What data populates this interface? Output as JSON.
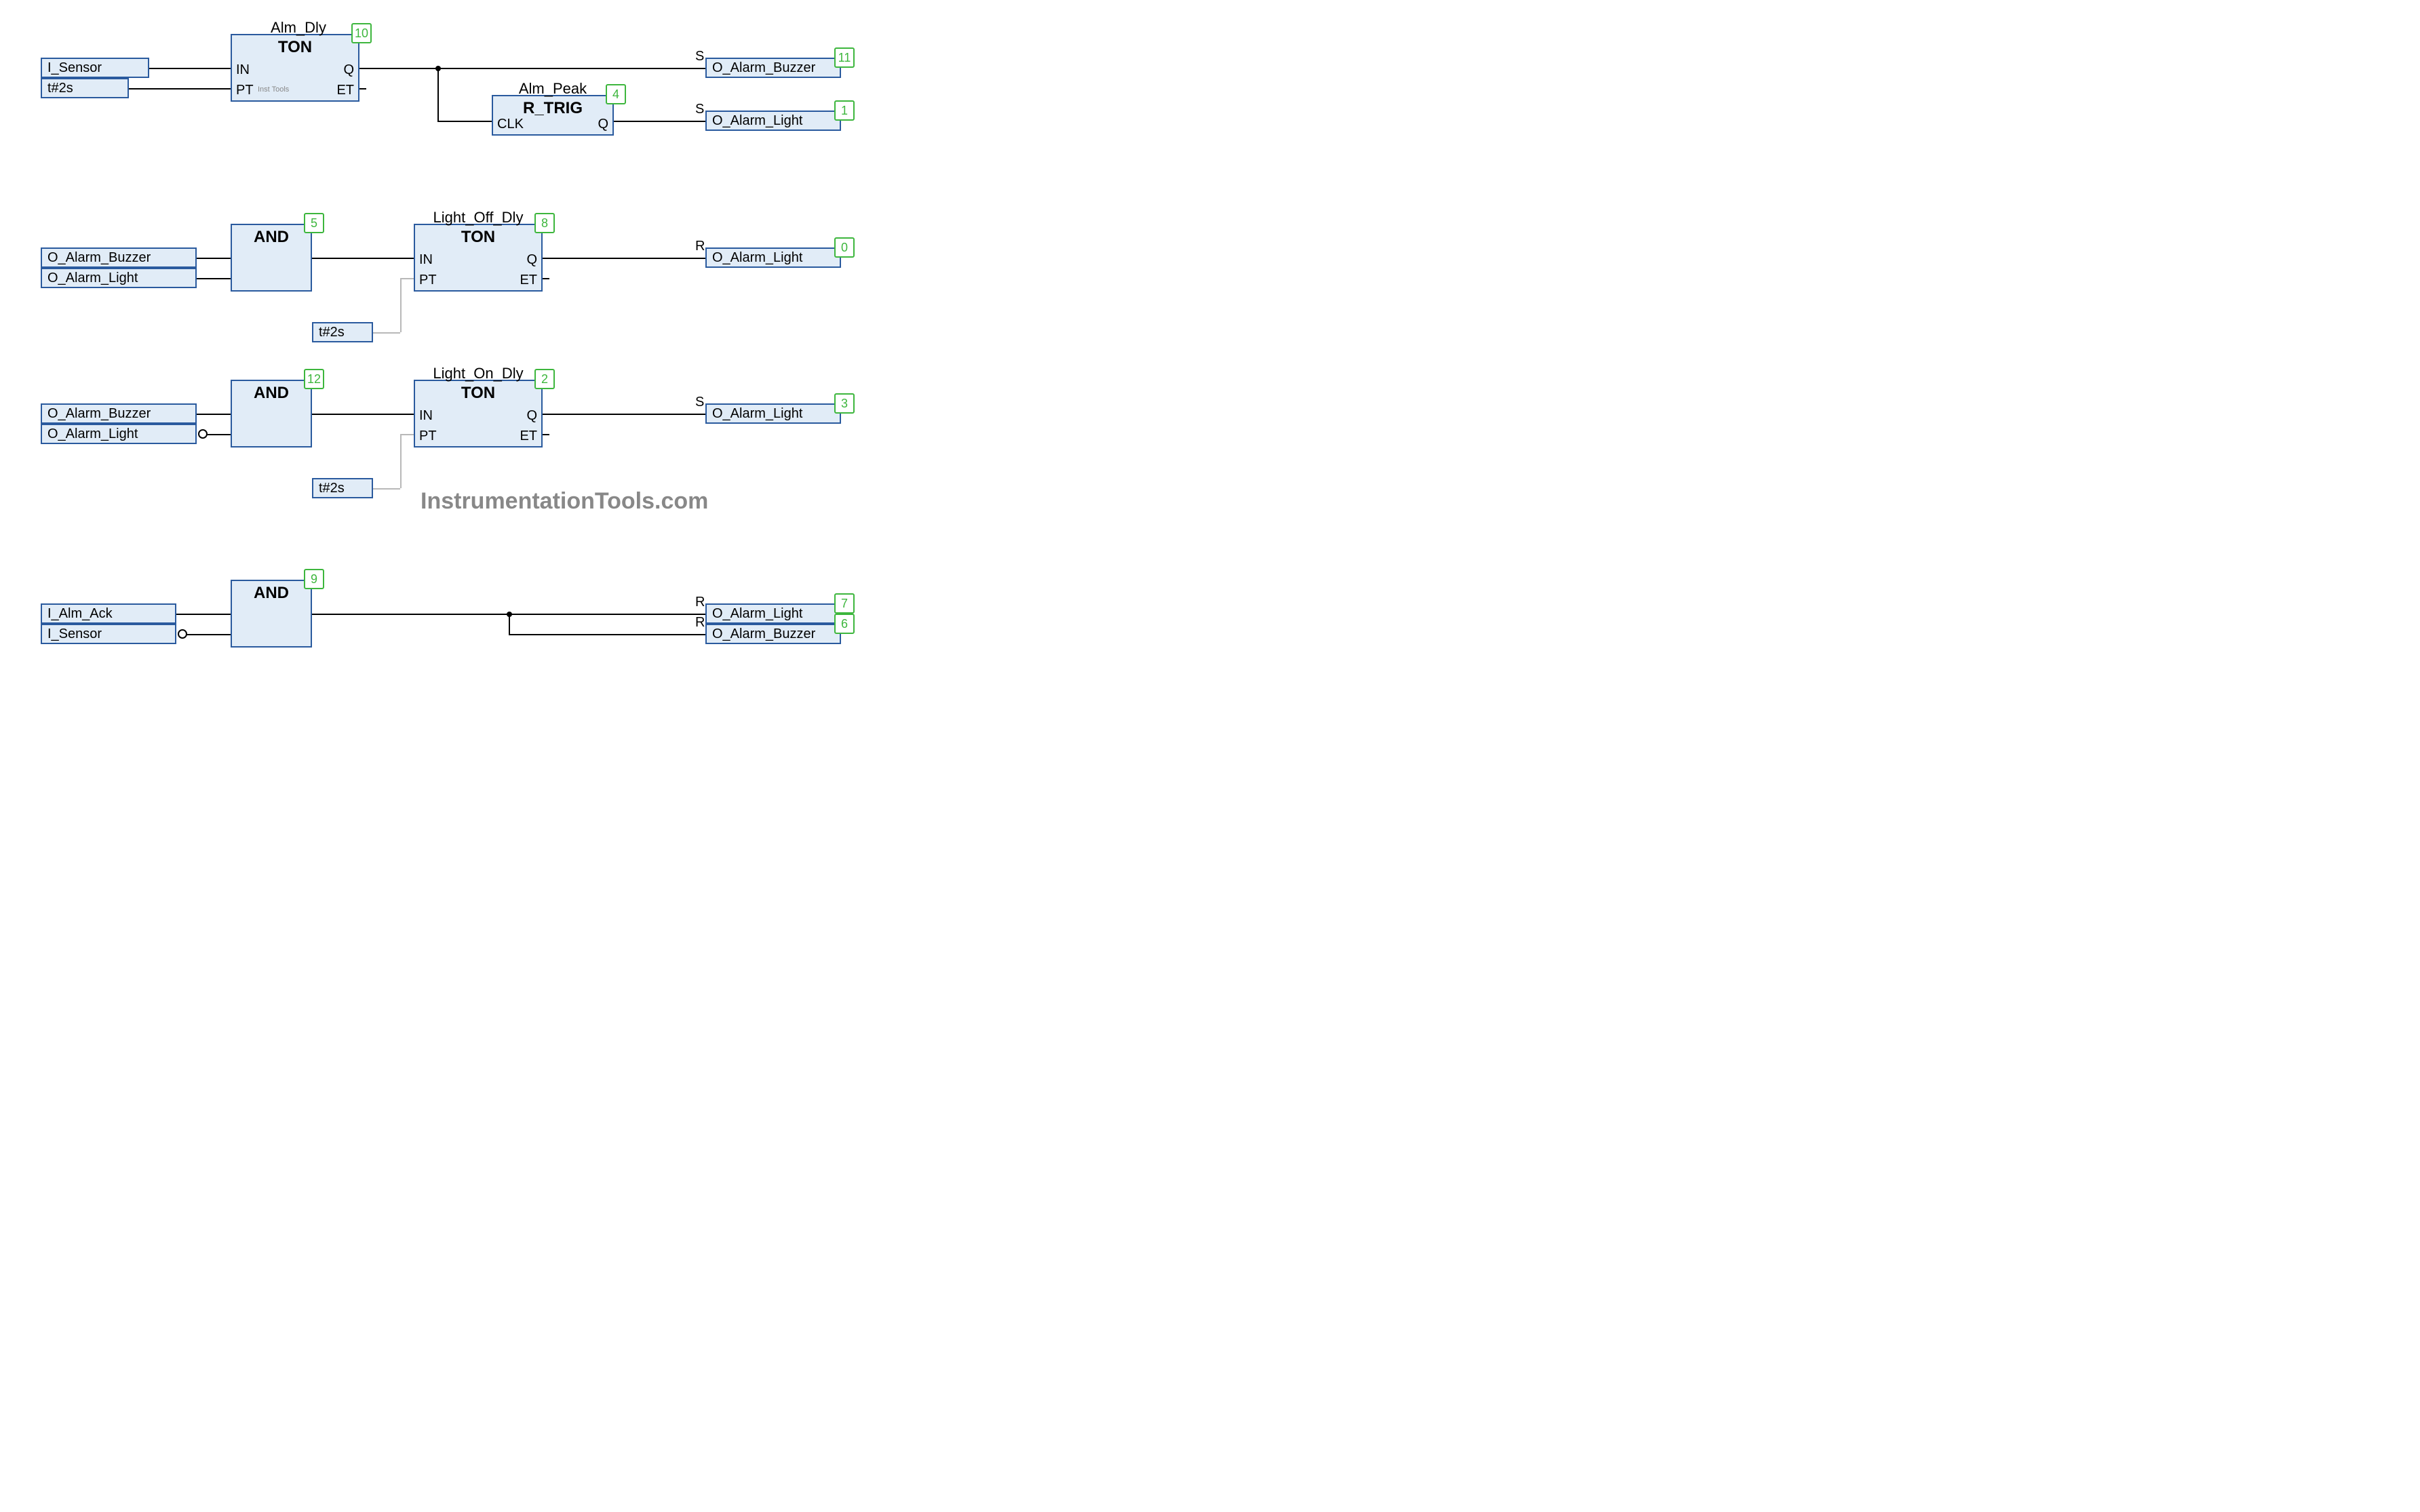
{
  "blocks": {
    "ton1": {
      "type": "TON",
      "instance": "Alm_Dly",
      "exec": "10",
      "pins": {
        "in": "IN",
        "pt": "PT",
        "q": "Q",
        "et": "ET"
      }
    },
    "rtrig": {
      "type": "R_TRIG",
      "instance": "Alm_Peak",
      "exec": "4",
      "pins": {
        "clk": "CLK",
        "q": "Q"
      }
    },
    "and1": {
      "type": "AND",
      "exec": "5"
    },
    "ton2": {
      "type": "TON",
      "instance": "Light_Off_Dly",
      "exec": "8",
      "pins": {
        "in": "IN",
        "pt": "PT",
        "q": "Q",
        "et": "ET"
      }
    },
    "and2": {
      "type": "AND",
      "exec": "12"
    },
    "ton3": {
      "type": "TON",
      "instance": "Light_On_Dly",
      "exec": "2",
      "pins": {
        "in": "IN",
        "pt": "PT",
        "q": "Q",
        "et": "ET"
      }
    },
    "and3": {
      "type": "AND",
      "exec": "9"
    }
  },
  "vars": {
    "i_sensor1": "I_Sensor",
    "t2s_1": "t#2s",
    "o_buz_out1": "O_Alarm_Buzzer",
    "o_light_out1": "O_Alarm_Light",
    "o_buz_in2": "O_Alarm_Buzzer",
    "o_light_in2": "O_Alarm_Light",
    "t2s_2": "t#2s",
    "o_light_out2": "O_Alarm_Light",
    "o_buz_in3": "O_Alarm_Buzzer",
    "o_light_in3": "O_Alarm_Light",
    "t2s_3": "t#2s",
    "o_light_out3": "O_Alarm_Light",
    "i_alm_ack": "I_Alm_Ack",
    "i_sensor4": "I_Sensor",
    "o_light_out4": "O_Alarm_Light",
    "o_buz_out4": "O_Alarm_Buzzer"
  },
  "qualifiers": {
    "s": "S",
    "r": "R"
  },
  "exec_badges": {
    "out_buz1": "11",
    "out_light1": "1",
    "out_light2": "0",
    "out_light3": "3",
    "out_light4": "7",
    "out_buz4": "6"
  },
  "watermarks": {
    "small": "Inst Tools",
    "big": "InstrumentationTools.com"
  }
}
